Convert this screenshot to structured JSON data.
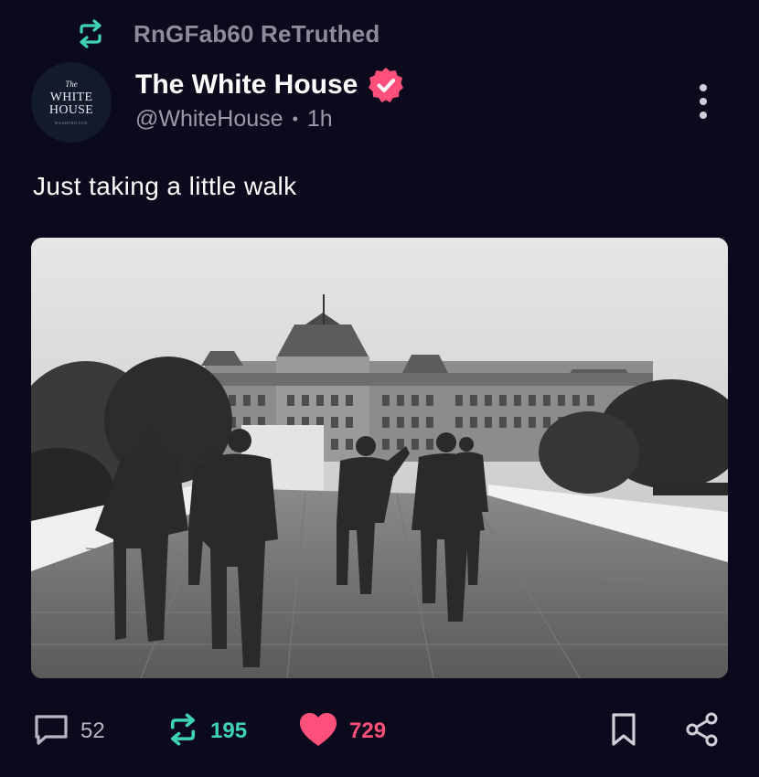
{
  "retruth": {
    "text": "RnGFab60 ReTruthed",
    "icon": "retruth-icon",
    "color": "#3fd3b6"
  },
  "author": {
    "avatar": {
      "the": "The",
      "line1": "WHITE",
      "line2": "HOUSE",
      "sub": "WASHINGTON"
    },
    "display_name": "The White House",
    "verified_icon": "verified-badge-icon",
    "verified_color": "#ff4f7b",
    "handle": "@WhiteHouse",
    "separator": "•",
    "time": "1h"
  },
  "menu": {
    "icon": "more-vertical-icon"
  },
  "post": {
    "text": "Just taking a little walk",
    "image_description": "black-and-white-photo"
  },
  "actions": {
    "reply": {
      "icon": "comment-icon",
      "count": "52"
    },
    "repost": {
      "icon": "retruth-icon",
      "count": "195"
    },
    "like": {
      "icon": "heart-icon",
      "count": "729"
    },
    "bookmark": {
      "icon": "bookmark-icon"
    },
    "share": {
      "icon": "share-icon"
    }
  },
  "colors": {
    "background": "#0a0a1c",
    "accent_green": "#3fd3b6",
    "accent_pink": "#ff4f7b",
    "muted_text": "#9a9aaa"
  }
}
